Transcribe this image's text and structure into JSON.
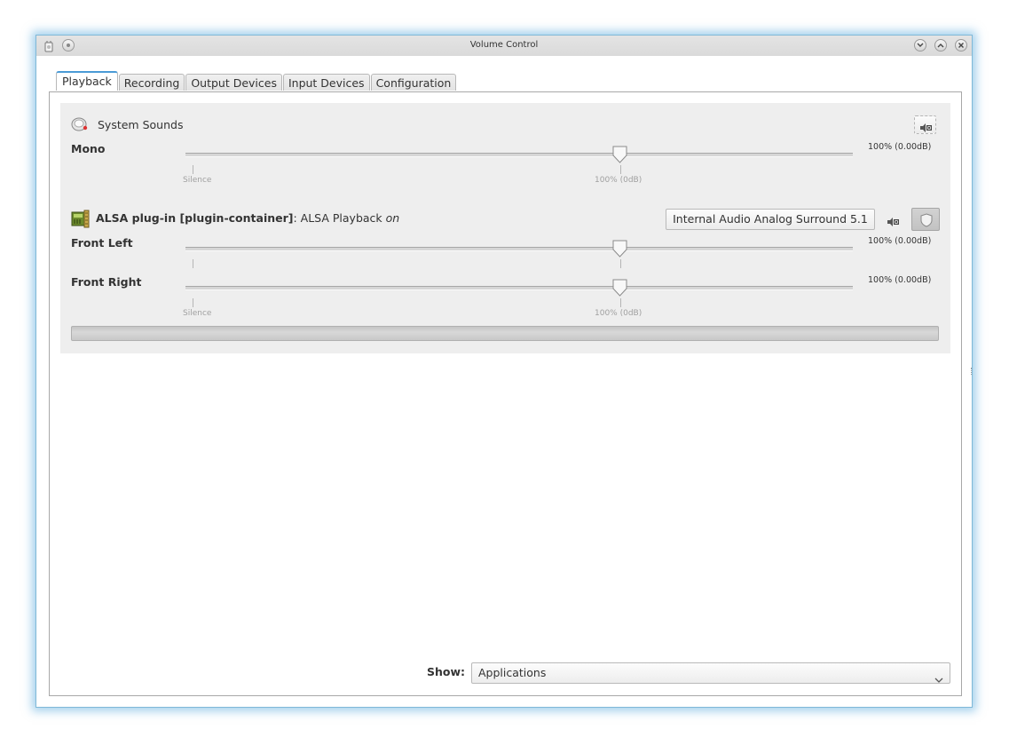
{
  "window": {
    "title": "Volume Control"
  },
  "tabs": [
    {
      "label": "Playback",
      "active": true
    },
    {
      "label": "Recording",
      "active": false
    },
    {
      "label": "Output Devices",
      "active": false
    },
    {
      "label": "Input Devices",
      "active": false
    },
    {
      "label": "Configuration",
      "active": false
    }
  ],
  "streams": {
    "system_sounds": {
      "name": "System Sounds",
      "icon": "system-sounds-icon",
      "channels": [
        {
          "label": "Mono",
          "value_text": "100% (0.00dB)",
          "level_percent": 100
        }
      ],
      "scale_marks": {
        "silence": "Silence",
        "norm": "100% (0dB)"
      },
      "mute_icon": "speaker-mute-icon"
    },
    "alsa_plugin": {
      "name_bold": "ALSA plug-in [plugin-container]",
      "separator": ": ",
      "description": "ALSA Playback ",
      "status": "on",
      "icon": "plugin-app-icon",
      "device": "Internal Audio Analog Surround 5.1",
      "channels": [
        {
          "label": "Front Left",
          "value_text": "100% (0.00dB)",
          "level_percent": 100
        },
        {
          "label": "Front Right",
          "value_text": "100% (0.00dB)",
          "level_percent": 100
        }
      ],
      "scale_marks": {
        "silence": "Silence",
        "norm": "100% (0dB)"
      },
      "peak_level_percent": 0
    }
  },
  "footer": {
    "show_label": "Show:",
    "show_value": "Applications"
  }
}
